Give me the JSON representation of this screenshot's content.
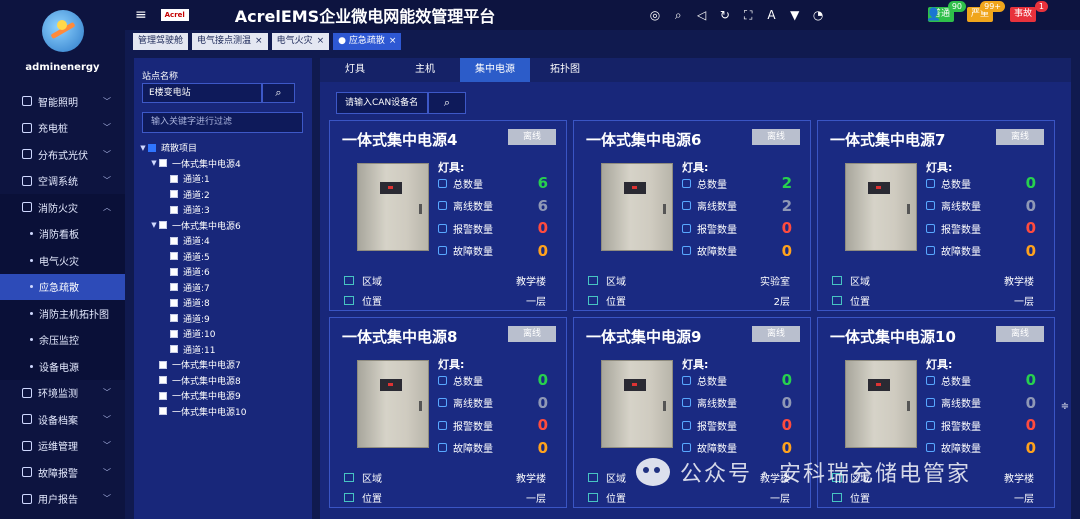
{
  "user": {
    "name": "adminenergy"
  },
  "sidebar": {
    "items": [
      {
        "label": "智能照明",
        "icon": "lightbulb-icon"
      },
      {
        "label": "充电桩",
        "icon": "charging-pile-icon"
      },
      {
        "label": "分布式光伏",
        "icon": "solar-panel-icon"
      },
      {
        "label": "空调系统",
        "icon": "air-conditioner-icon"
      },
      {
        "label": "消防火灾",
        "icon": "fire-extinguisher-icon",
        "expanded": true
      },
      {
        "label": "环境监测",
        "icon": "environment-icon"
      },
      {
        "label": "设备档案",
        "icon": "device-file-icon"
      },
      {
        "label": "运维管理",
        "icon": "maintenance-icon"
      },
      {
        "label": "故障报警",
        "icon": "alarm-icon"
      },
      {
        "label": "用户报告",
        "icon": "report-icon"
      }
    ],
    "subitems": [
      {
        "label": "消防看板"
      },
      {
        "label": "电气火灾"
      },
      {
        "label": "应急疏散",
        "active": true
      },
      {
        "label": "消防主机拓扑图"
      },
      {
        "label": "余压监控"
      },
      {
        "label": "设备电源"
      }
    ]
  },
  "header": {
    "logo_text": "Acrel",
    "title": "AcrelEMS企业微电网能效管理平台",
    "icons": [
      "globe-icon",
      "search-icon",
      "volume-icon",
      "refresh-icon",
      "fullscreen-icon",
      "font-size-icon",
      "shirt-icon",
      "compass-icon"
    ],
    "alerts": [
      {
        "label": "普通",
        "count": "90",
        "color": "#2fbf4a"
      },
      {
        "label": "严重",
        "count": "99+",
        "color": "#f0a51c"
      },
      {
        "label": "事故",
        "count": "1",
        "color": "#e8323c"
      }
    ]
  },
  "tabs": [
    {
      "label": "管理驾驶舱",
      "closable": false
    },
    {
      "label": "电气接点测温",
      "closable": true
    },
    {
      "label": "电气火灾",
      "closable": true
    },
    {
      "label": "应急疏散",
      "closable": true,
      "active": true
    }
  ],
  "tree_panel": {
    "label": "站点名称",
    "station_value": "E楼变电站",
    "filter_placeholder": "输入关键字进行过滤",
    "nodes": [
      {
        "label": "疏散项目",
        "level": 0,
        "checked": true,
        "arrow": "down"
      },
      {
        "label": "一体式集中电源4",
        "level": 1,
        "arrow": "down"
      },
      {
        "label": "通道:1",
        "level": 2
      },
      {
        "label": "通道:2",
        "level": 2
      },
      {
        "label": "通道:3",
        "level": 2
      },
      {
        "label": "一体式集中电源6",
        "level": 1,
        "arrow": "down"
      },
      {
        "label": "通道:4",
        "level": 2
      },
      {
        "label": "通道:5",
        "level": 2
      },
      {
        "label": "通道:6",
        "level": 2
      },
      {
        "label": "通道:7",
        "level": 2
      },
      {
        "label": "通道:8",
        "level": 2
      },
      {
        "label": "通道:9",
        "level": 2
      },
      {
        "label": "通道:10",
        "level": 2
      },
      {
        "label": "通道:11",
        "level": 2
      },
      {
        "label": "一体式集中电源7",
        "level": 1
      },
      {
        "label": "一体式集中电源8",
        "level": 1
      },
      {
        "label": "一体式集中电源9",
        "level": 1
      },
      {
        "label": "一体式集中电源10",
        "level": 1
      }
    ]
  },
  "main": {
    "tabs": [
      {
        "label": "灯具"
      },
      {
        "label": "主机"
      },
      {
        "label": "集中电源",
        "active": true
      },
      {
        "label": "拓扑图"
      }
    ],
    "can_placeholder": "请输入CAN设备名",
    "lamp_label": "灯具:",
    "stat_labels": [
      "总数量",
      "离线数量",
      "报警数量",
      "故障数量"
    ],
    "stat_icons": [
      "total-icon",
      "offline-icon",
      "alarm-bell-icon",
      "fault-warning-icon"
    ],
    "area_label": "区域",
    "position_label": "位置",
    "cards": [
      {
        "title": "一体式集中电源4",
        "status": "离线",
        "total": "6",
        "offline": "6",
        "alarm": "0",
        "fault": "0",
        "area": "教学楼",
        "position": "一层"
      },
      {
        "title": "一体式集中电源6",
        "status": "离线",
        "total": "2",
        "offline": "2",
        "alarm": "0",
        "fault": "0",
        "area": "实验室",
        "position": "2层"
      },
      {
        "title": "一体式集中电源7",
        "status": "离线",
        "total": "0",
        "offline": "0",
        "alarm": "0",
        "fault": "0",
        "area": "教学楼",
        "position": "一层"
      },
      {
        "title": "一体式集中电源8",
        "status": "离线",
        "total": "0",
        "offline": "0",
        "alarm": "0",
        "fault": "0",
        "area": "教学楼",
        "position": "一层"
      },
      {
        "title": "一体式集中电源9",
        "status": "离线",
        "total": "0",
        "offline": "0",
        "alarm": "0",
        "fault": "0",
        "area": "教学楼",
        "position": "一层"
      },
      {
        "title": "一体式集中电源10",
        "status": "离线",
        "total": "0",
        "offline": "0",
        "alarm": "0",
        "fault": "0",
        "area": "教学楼",
        "position": "一层"
      }
    ]
  },
  "watermark": {
    "text": "公众号 · 安科瑞充储电管家"
  },
  "colors": {
    "green": "#27d14e",
    "gray": "#8f98b6",
    "red": "#ff4b3e",
    "orange": "#ffa21d",
    "accent": "#2c5cc9"
  }
}
